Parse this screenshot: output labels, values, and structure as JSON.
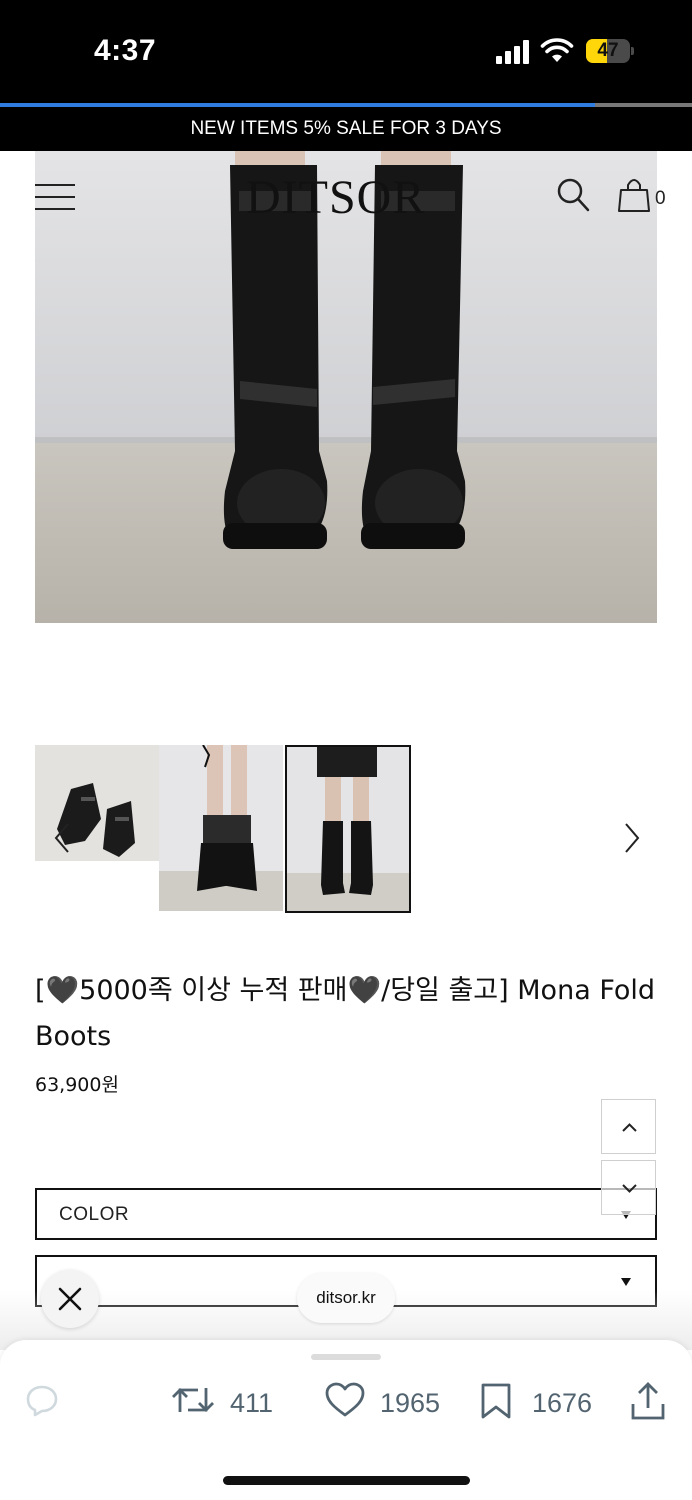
{
  "status_bar": {
    "time": "4:37",
    "battery": "47",
    "battery_level": 0.47
  },
  "page_load_progress": 0.86,
  "promo_banner": "NEW ITEMS 5% SALE FOR 3 DAYS",
  "header": {
    "logo": "DITSOR",
    "cart_count": "0"
  },
  "gallery": {
    "thumbnails": [
      "folded-boots-pair",
      "boots-worn-folded",
      "boots-worn-full-length"
    ],
    "selected_index": 2
  },
  "product": {
    "title": "[🖤5000족 이상 누적 판매🖤/당일 출고] Mona Fold Boots",
    "price": "63,900원"
  },
  "options": {
    "color_label": "COLOR",
    "size_label": "-"
  },
  "browser": {
    "domain": "ditsor.kr"
  },
  "social_actions": {
    "retweets": "411",
    "likes": "1965",
    "bookmarks": "1676"
  },
  "colors": {
    "accent_progress": "#2f7de1",
    "battery_yellow": "#ffd60a",
    "icon_gray": "#536471"
  },
  "icons": [
    "hamburger-menu-icon",
    "search-icon",
    "shopping-bag-icon",
    "chevron-left-icon",
    "chevron-right-icon",
    "chevron-up-icon",
    "chevron-down-icon",
    "close-icon",
    "reply-icon",
    "retweet-icon",
    "heart-icon",
    "bookmark-icon",
    "share-icon"
  ]
}
